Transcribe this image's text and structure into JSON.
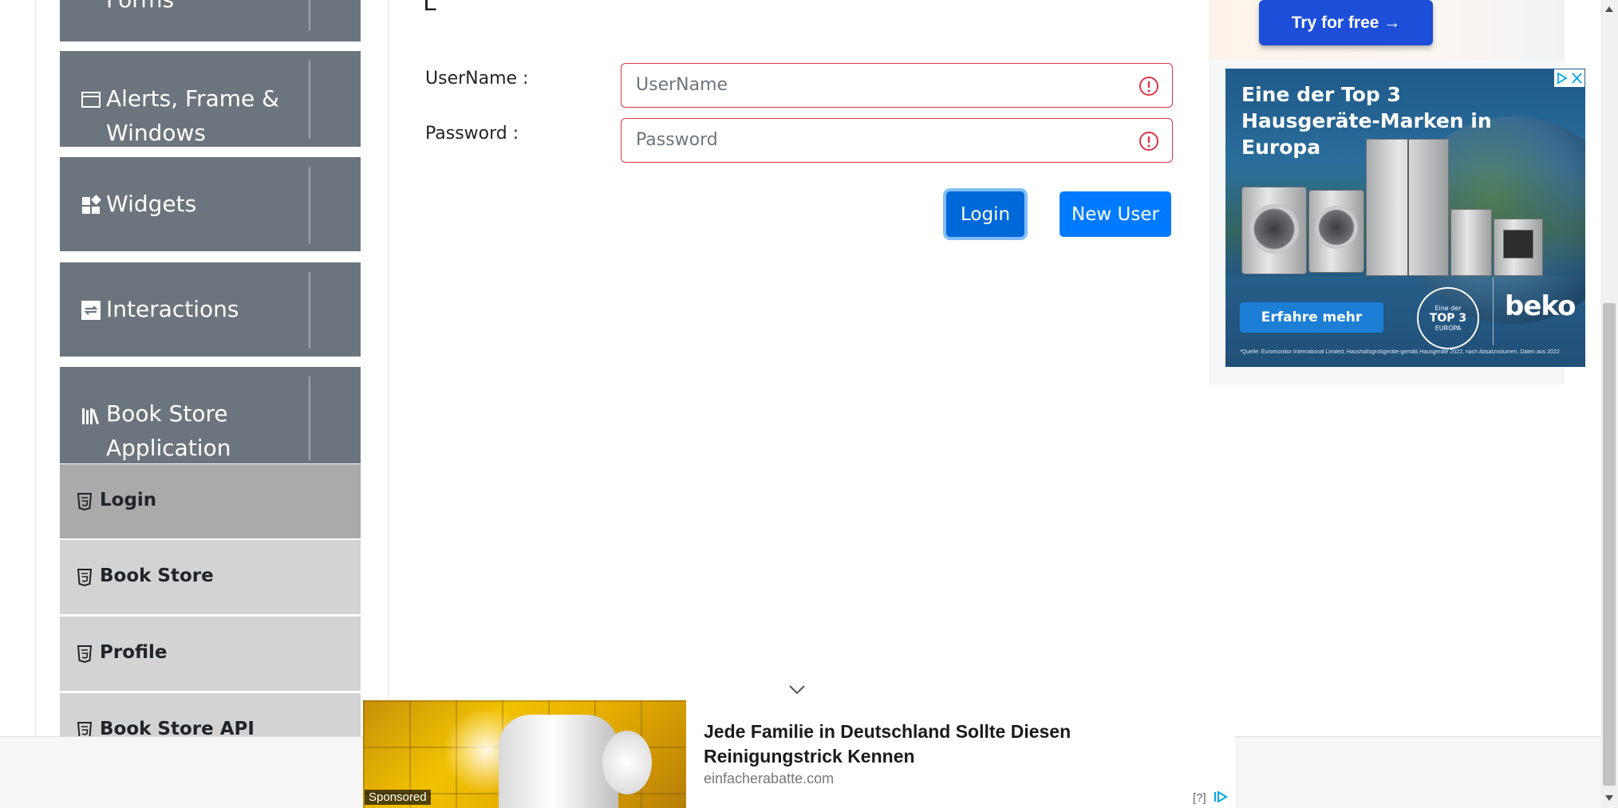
{
  "sidebar": {
    "groups": [
      {
        "label": "Forms"
      },
      {
        "label_line1": "Alerts, Frame &",
        "label_line2": "Windows"
      },
      {
        "label": "Widgets"
      },
      {
        "label": "Interactions"
      },
      {
        "label_line1": "Book Store",
        "label_line2": "Application"
      }
    ],
    "subitems": [
      {
        "label": "Login",
        "active": true
      },
      {
        "label": "Book Store"
      },
      {
        "label": "Profile"
      },
      {
        "label": "Book Store API"
      }
    ]
  },
  "form": {
    "username_label": "UserName :",
    "username_placeholder": "UserName",
    "username_value": "",
    "password_label": "Password :",
    "password_placeholder": "Password",
    "password_value": "",
    "login_button": "Login",
    "new_user_button": "New User",
    "error_color": "#dc3545",
    "primary_color": "#007bff"
  },
  "ads": {
    "top_cta": "Try for free →",
    "beko": {
      "headline": "Eine der Top 3 Hausgeräte-Marken in Europa",
      "cta": "Erfahre mehr",
      "seal_top": "Eine der",
      "seal_main": "TOP 3",
      "seal_bottom": "EUROPA",
      "brand": "beko",
      "footnote": "*Quelle: Euromonitor International Limited; Haushaltsgroßgeräte-gemäß Hausgeräte 2022, nach Absatzvolumen, Daten aus 2022"
    },
    "sponsored": {
      "label": "Sponsored",
      "title": "Jede Familie in Deutschland Sollte Diesen Reinigungstrick Kennen",
      "domain": "einfacherabatte.com",
      "help": "[?]"
    }
  }
}
